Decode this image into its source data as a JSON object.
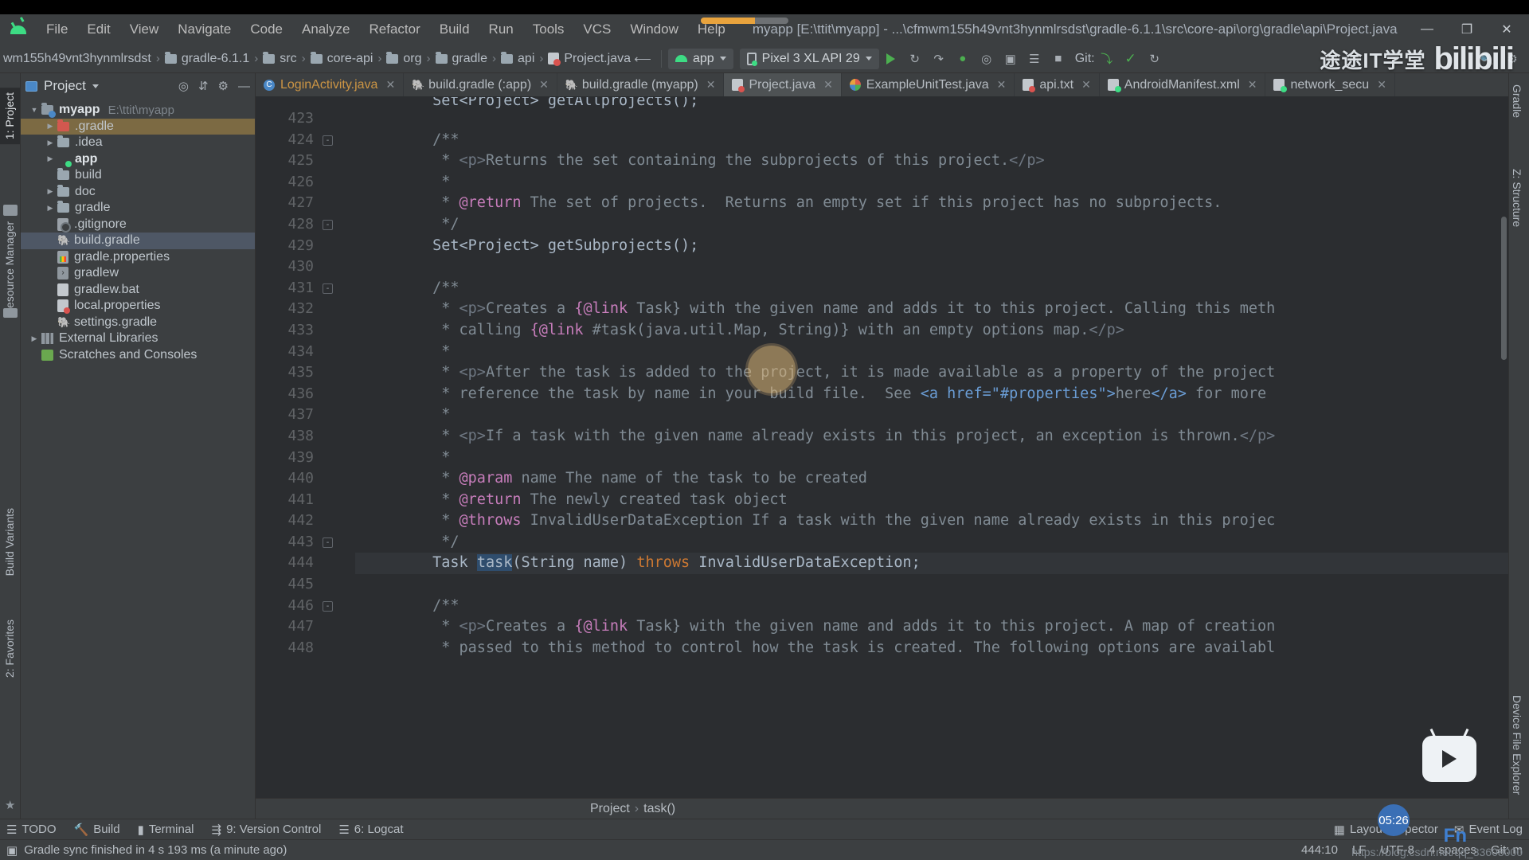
{
  "window": {
    "title": "myapp [E:\\ttit\\myapp] - ...\\cfmwm155h49vnt3hynmlrsdst\\gradle-6.1.1\\src\\core-api\\org\\gradle\\api\\Project.java",
    "minimize": "—",
    "maximize": "❐",
    "close": "✕"
  },
  "menu": {
    "logo": "android-logo-icon",
    "items": [
      "File",
      "Edit",
      "View",
      "Navigate",
      "Code",
      "Analyze",
      "Refactor",
      "Build",
      "Run",
      "Tools",
      "VCS",
      "Window",
      "Help"
    ]
  },
  "navbar": {
    "crumbs": [
      "wm155h49vnt3hynmlrsdst",
      "gradle-6.1.1",
      "src",
      "core-api",
      "org",
      "gradle",
      "api",
      "Project.java"
    ],
    "module": "app",
    "device": "Pixel 3 XL API 29",
    "git_label": "Git:",
    "separator": "›"
  },
  "watermark": {
    "text": "途途IT学堂",
    "brand": "bilibili"
  },
  "rails": {
    "left": [
      "1: Project",
      "Resource Manager",
      "Build Variants",
      "2: Favorites"
    ],
    "right": [
      "Gradle",
      "Z: Structure",
      "Device File Explorer"
    ]
  },
  "project": {
    "title": "Project",
    "locate_icon": "locate-icon",
    "collapse_icon": "collapse-all-icon",
    "settings_icon": "gear-icon",
    "hide_icon": "hide-icon",
    "tree": [
      {
        "label": "myapp",
        "path": "E:\\ttit\\myapp",
        "arrow": "d",
        "icon": "mod",
        "indent": 0,
        "bold": true,
        "state": ""
      },
      {
        "label": ".gradle",
        "path": "",
        "arrow": "r",
        "icon": "red",
        "indent": 1,
        "bold": false,
        "state": "sel-a"
      },
      {
        "label": ".idea",
        "path": "",
        "arrow": "r",
        "icon": "gray",
        "indent": 1,
        "bold": false,
        "state": ""
      },
      {
        "label": "app",
        "path": "",
        "arrow": "r",
        "icon": "dot",
        "indent": 1,
        "bold": true,
        "state": ""
      },
      {
        "label": "build",
        "path": "",
        "arrow": "",
        "icon": "gray",
        "indent": 1,
        "bold": false,
        "state": ""
      },
      {
        "label": "doc",
        "path": "",
        "arrow": "r",
        "icon": "gray",
        "indent": 1,
        "bold": false,
        "state": ""
      },
      {
        "label": "gradle",
        "path": "",
        "arrow": "r",
        "icon": "gray",
        "indent": 1,
        "bold": false,
        "state": ""
      },
      {
        "label": ".gitignore",
        "path": "",
        "arrow": "",
        "icon": "git",
        "indent": 1,
        "bold": false,
        "state": ""
      },
      {
        "label": "build.gradle",
        "path": "",
        "arrow": "",
        "icon": "elephant",
        "indent": 1,
        "bold": false,
        "state": "sel-b"
      },
      {
        "label": "gradle.properties",
        "path": "",
        "arrow": "",
        "icon": "props",
        "indent": 1,
        "bold": false,
        "state": ""
      },
      {
        "label": "gradlew",
        "path": "",
        "arrow": "",
        "icon": "sh",
        "indent": 1,
        "bold": false,
        "state": ""
      },
      {
        "label": "gradlew.bat",
        "path": "",
        "arrow": "",
        "icon": "bat",
        "indent": 1,
        "bold": false,
        "state": ""
      },
      {
        "label": "local.properties",
        "path": "",
        "arrow": "",
        "icon": "jv",
        "indent": 1,
        "bold": false,
        "state": ""
      },
      {
        "label": "settings.gradle",
        "path": "",
        "arrow": "",
        "icon": "elephant",
        "indent": 1,
        "bold": false,
        "state": ""
      },
      {
        "label": "External Libraries",
        "path": "",
        "arrow": "r",
        "icon": "lib",
        "indent": 0,
        "bold": false,
        "state": ""
      },
      {
        "label": "Scratches and Consoles",
        "path": "",
        "arrow": "",
        "icon": "scr",
        "indent": 0,
        "bold": false,
        "state": ""
      }
    ]
  },
  "tabs": [
    {
      "label": "LoginActivity.java",
      "icon": "c",
      "active": false,
      "orange": true
    },
    {
      "label": "build.gradle (:app)",
      "icon": "grd",
      "active": false,
      "orange": false
    },
    {
      "label": "build.gradle (myapp)",
      "icon": "grd",
      "active": false,
      "orange": false
    },
    {
      "label": "Project.java",
      "icon": "jv",
      "active": true,
      "orange": false
    },
    {
      "label": "ExampleUnitTest.java",
      "icon": "test",
      "active": false,
      "orange": false
    },
    {
      "label": "api.txt",
      "icon": "jv",
      "active": false,
      "orange": false
    },
    {
      "label": "AndroidManifest.xml",
      "icon": "xml",
      "active": false,
      "orange": false
    },
    {
      "label": "network_secu",
      "icon": "xml",
      "active": false,
      "orange": false
    }
  ],
  "editor": {
    "first_partial_line": "Set<Project> getAllprojects();",
    "lines": [
      {
        "n": "423",
        "fold": "",
        "cur": false,
        "html": ""
      },
      {
        "n": "424",
        "fold": "-",
        "cur": false,
        "html": "        <span class='cmt'>/**</span>"
      },
      {
        "n": "425",
        "fold": "",
        "cur": false,
        "html": "         <span class='cmt'>* </span><span class='tag'>&lt;p&gt;</span><span class='cmt'>Returns the set containing the subprojects of this project.</span><span class='tag'>&lt;/p&gt;</span>"
      },
      {
        "n": "426",
        "fold": "",
        "cur": false,
        "html": "         <span class='cmt'>*</span>"
      },
      {
        "n": "427",
        "fold": "",
        "cur": false,
        "html": "         <span class='cmt'>* </span><span class='doctag'>@return</span><span class='cmt'> The set of projects.  Returns an empty set if this project has no subprojects.</span>"
      },
      {
        "n": "428",
        "fold": "-",
        "cur": false,
        "html": "         <span class='cmt'>*/</span>"
      },
      {
        "n": "429",
        "fold": "",
        "cur": false,
        "html": "        <span class='typ'>Set&lt;Project&gt; getSubprojects();</span>"
      },
      {
        "n": "430",
        "fold": "",
        "cur": false,
        "html": ""
      },
      {
        "n": "431",
        "fold": "-",
        "cur": false,
        "html": "        <span class='cmt'>/**</span>"
      },
      {
        "n": "432",
        "fold": "",
        "cur": false,
        "html": "         <span class='cmt'>* </span><span class='tag'>&lt;p&gt;</span><span class='cmt'>Creates a </span><span class='lnk'>{@link</span><span class='cmt'> Task} with the given name and adds it to this project. Calling this meth</span>"
      },
      {
        "n": "433",
        "fold": "",
        "cur": false,
        "html": "         <span class='cmt'>* calling </span><span class='lnk'>{@link</span><span class='cmt'> #task(java.util.Map, String)} with an empty options map.</span><span class='tag'>&lt;/p&gt;</span>"
      },
      {
        "n": "434",
        "fold": "",
        "cur": false,
        "html": "         <span class='cmt'>*</span>"
      },
      {
        "n": "435",
        "fold": "",
        "cur": false,
        "html": "         <span class='cmt'>* </span><span class='tag'>&lt;p&gt;</span><span class='cmt'>After the task is added to the project, it is made available as a property of the project</span>"
      },
      {
        "n": "436",
        "fold": "",
        "cur": false,
        "html": "         <span class='cmt'>* reference the task by name in your build file.  See </span><span class='href'>&lt;a href=\"#properties\"&gt;</span><span class='cmt'>here</span><span class='href'>&lt;/a&gt;</span><span class='cmt'> for more</span>"
      },
      {
        "n": "437",
        "fold": "",
        "cur": false,
        "html": "         <span class='cmt'>*</span>"
      },
      {
        "n": "438",
        "fold": "",
        "cur": false,
        "html": "         <span class='cmt'>* </span><span class='tag'>&lt;p&gt;</span><span class='cmt'>If a task with the given name already exists in this project, an exception is thrown.</span><span class='tag'>&lt;/p&gt;</span>"
      },
      {
        "n": "439",
        "fold": "",
        "cur": false,
        "html": "         <span class='cmt'>*</span>"
      },
      {
        "n": "440",
        "fold": "",
        "cur": false,
        "html": "         <span class='cmt'>* </span><span class='doctag'>@param</span><span class='cmt'> name The name of the task to be created</span>"
      },
      {
        "n": "441",
        "fold": "",
        "cur": false,
        "html": "         <span class='cmt'>* </span><span class='doctag'>@return</span><span class='cmt'> The newly created task object</span>"
      },
      {
        "n": "442",
        "fold": "",
        "cur": false,
        "html": "         <span class='cmt'>* </span><span class='doctag'>@throws</span><span class='cmt'> InvalidUserDataException If a task with the given name already exists in this projec</span>"
      },
      {
        "n": "443",
        "fold": "-",
        "cur": false,
        "html": "         <span class='cmt'>*/</span>"
      },
      {
        "n": "444",
        "fold": "",
        "cur": true,
        "html": "        <span class='typ'>Task </span><span class='sel'>task</span><span class='typ'>(String name) </span><span class='kw'>throws</span><span class='typ'> InvalidUserDataException;</span>"
      },
      {
        "n": "445",
        "fold": "",
        "cur": false,
        "html": ""
      },
      {
        "n": "446",
        "fold": "-",
        "cur": false,
        "html": "        <span class='cmt'>/**</span>"
      },
      {
        "n": "447",
        "fold": "",
        "cur": false,
        "html": "         <span class='cmt'>* </span><span class='tag'>&lt;p&gt;</span><span class='cmt'>Creates a </span><span class='lnk'>{@link</span><span class='cmt'> Task} with the given name and adds it to this project. A map of creation</span>"
      },
      {
        "n": "448",
        "fold": "",
        "cur": false,
        "html": "         <span class='cmt'>* passed to this method to control how the task is created. The following options are availabl</span>"
      }
    ]
  },
  "breadcrumb_bottom": {
    "items": [
      "Project",
      "task()"
    ],
    "separator": "›"
  },
  "toolwindows": {
    "items": [
      {
        "label": "TODO",
        "icon": "todo-icon"
      },
      {
        "label": "Build",
        "icon": "build-icon"
      },
      {
        "label": "Terminal",
        "icon": "terminal-icon"
      },
      {
        "label": "9: Version Control",
        "icon": "version-control-icon"
      },
      {
        "label": "6: Logcat",
        "icon": "logcat-icon"
      }
    ],
    "right": [
      {
        "label": "Layout Inspector",
        "icon": "layout-inspector-icon"
      },
      {
        "label": "Event Log",
        "icon": "event-log-icon"
      }
    ]
  },
  "status": {
    "message": "Gradle sync finished in 4 s 193 ms (a minute ago)",
    "caret": "444:10",
    "line_sep": "LF",
    "encoding": "UTF-8",
    "indent": "4 spaces",
    "git_branch": "Git: m",
    "timer": "05:26",
    "fn": "Fn",
    "blog": "https://blog.csdn.net/qq_33608000"
  },
  "colors": {
    "accent_green": "#3ddc84",
    "editor_bg": "#2b2d30",
    "panel_bg": "#3c3f41",
    "selection": "#7c6a43",
    "comment": "#808b94",
    "keyword": "#cc7832",
    "doctag": "#c77dbb"
  }
}
